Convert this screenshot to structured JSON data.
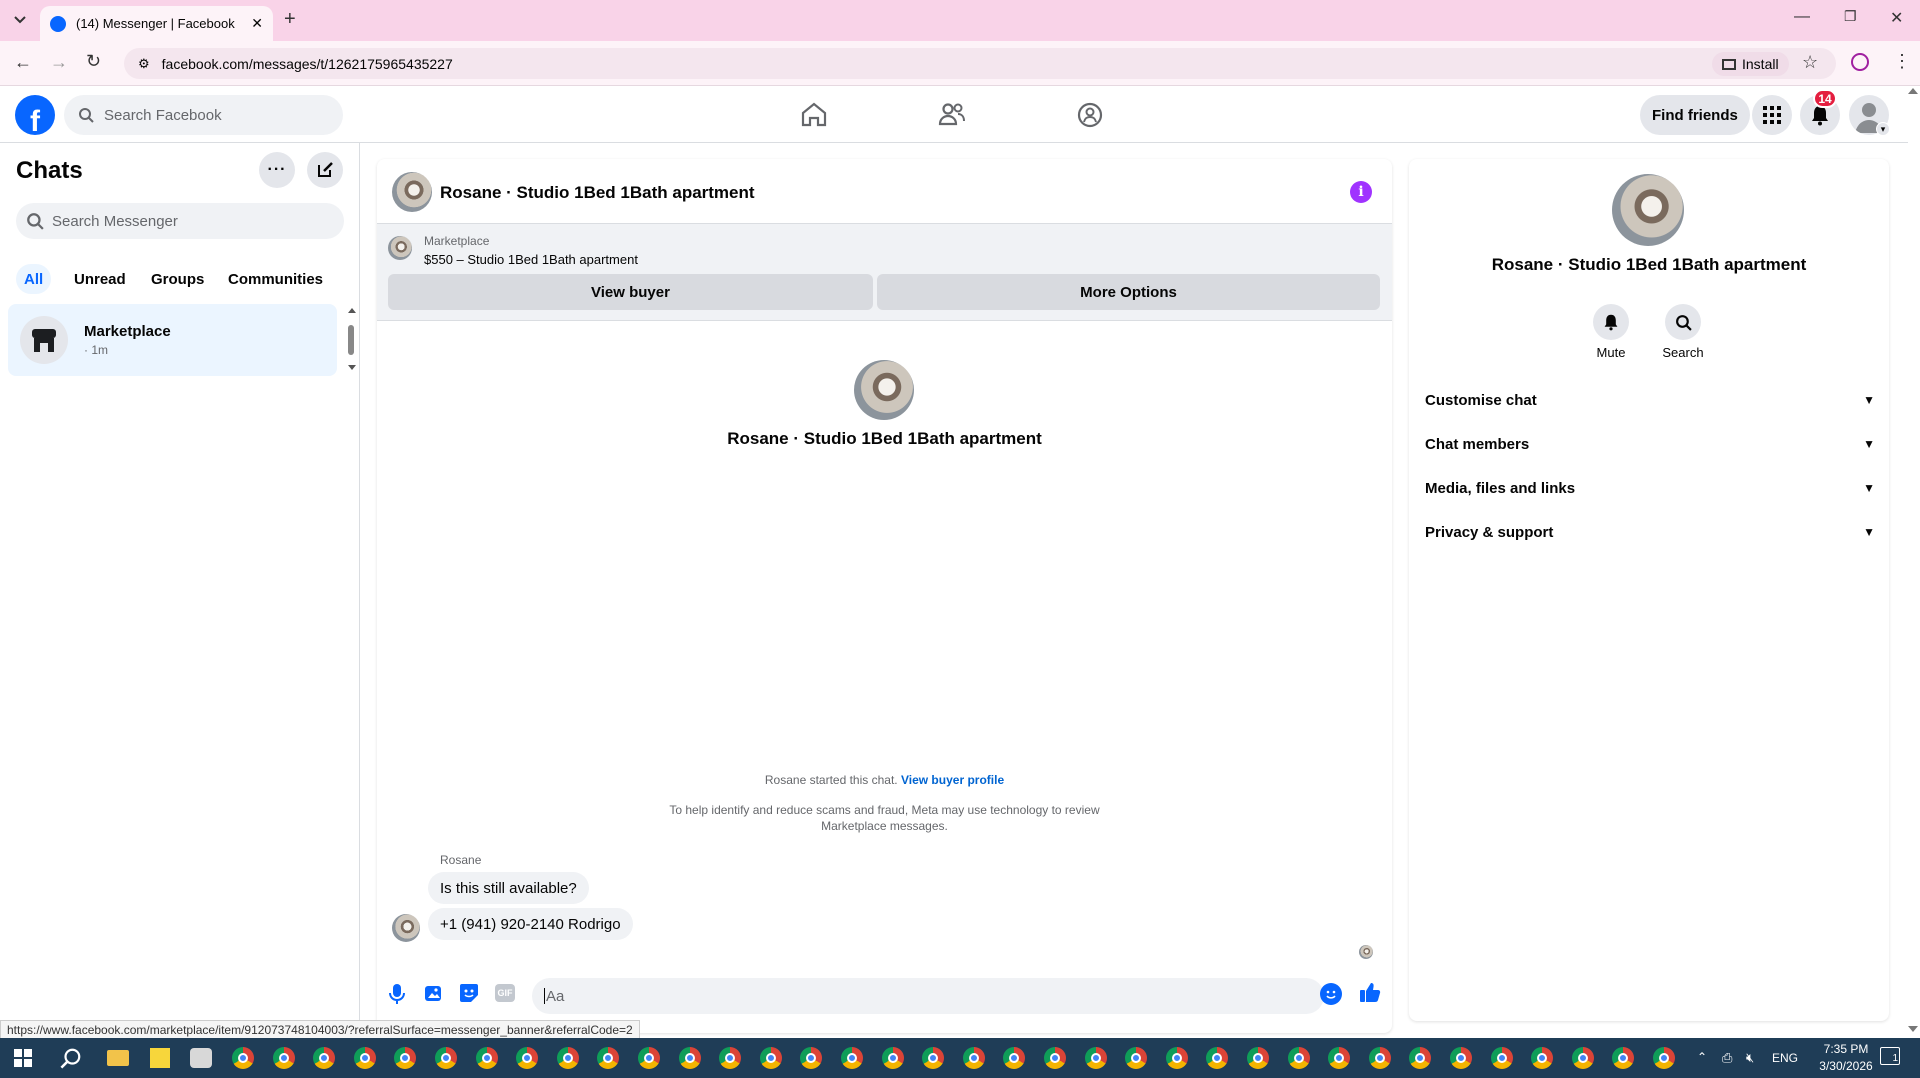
{
  "browser": {
    "tab_title": "(14) Messenger | Facebook",
    "url": "facebook.com/messages/t/1262175965435227",
    "install_label": "Install",
    "status_url": "https://www.facebook.com/marketplace/item/912073748104003/?referralSurface=messenger_banner&referralCode=2"
  },
  "fbnav": {
    "search_placeholder": "Search Facebook",
    "find_friends": "Find friends",
    "notification_count": "14"
  },
  "sidebar": {
    "title": "Chats",
    "search_placeholder": "Search Messenger",
    "filters": [
      "All",
      "Unread",
      "Groups",
      "Communities"
    ],
    "chat": {
      "name": "Marketplace",
      "time": "· 1m"
    }
  },
  "conversation": {
    "header_title": "Rosane · Studio 1Bed 1Bath apartment",
    "banner_label": "Marketplace",
    "banner_listing": "$550 – Studio 1Bed 1Bath apartment",
    "view_buyer": "View buyer",
    "more_options": "More Options",
    "intro_name": "Rosane · Studio 1Bed 1Bath apartment",
    "started_text": "Rosane started this chat.",
    "view_buyer_profile": "View buyer profile",
    "scam_notice_1": "To help identify and reduce scams and fraud, Meta may use technology to review",
    "scam_notice_2": "Marketplace messages.",
    "sender": "Rosane",
    "messages": [
      "Is this still available?",
      "+1 (941) 920-2140 Rodrigo"
    ],
    "composer_placeholder": "Aa"
  },
  "details": {
    "name": "Rosane · Studio 1Bed 1Bath apartment",
    "mute": "Mute",
    "search": "Search",
    "sections": [
      "Customise chat",
      "Chat members",
      "Media, files and links",
      "Privacy & support"
    ]
  },
  "taskbar": {
    "lang": "ENG",
    "time": "7:35 PM",
    "date": "3/30/2026",
    "notif": "1"
  },
  "colors": {
    "fb_blue": "#0866ff",
    "badge_red": "#e41e3f",
    "info_purple": "#a033ff"
  }
}
